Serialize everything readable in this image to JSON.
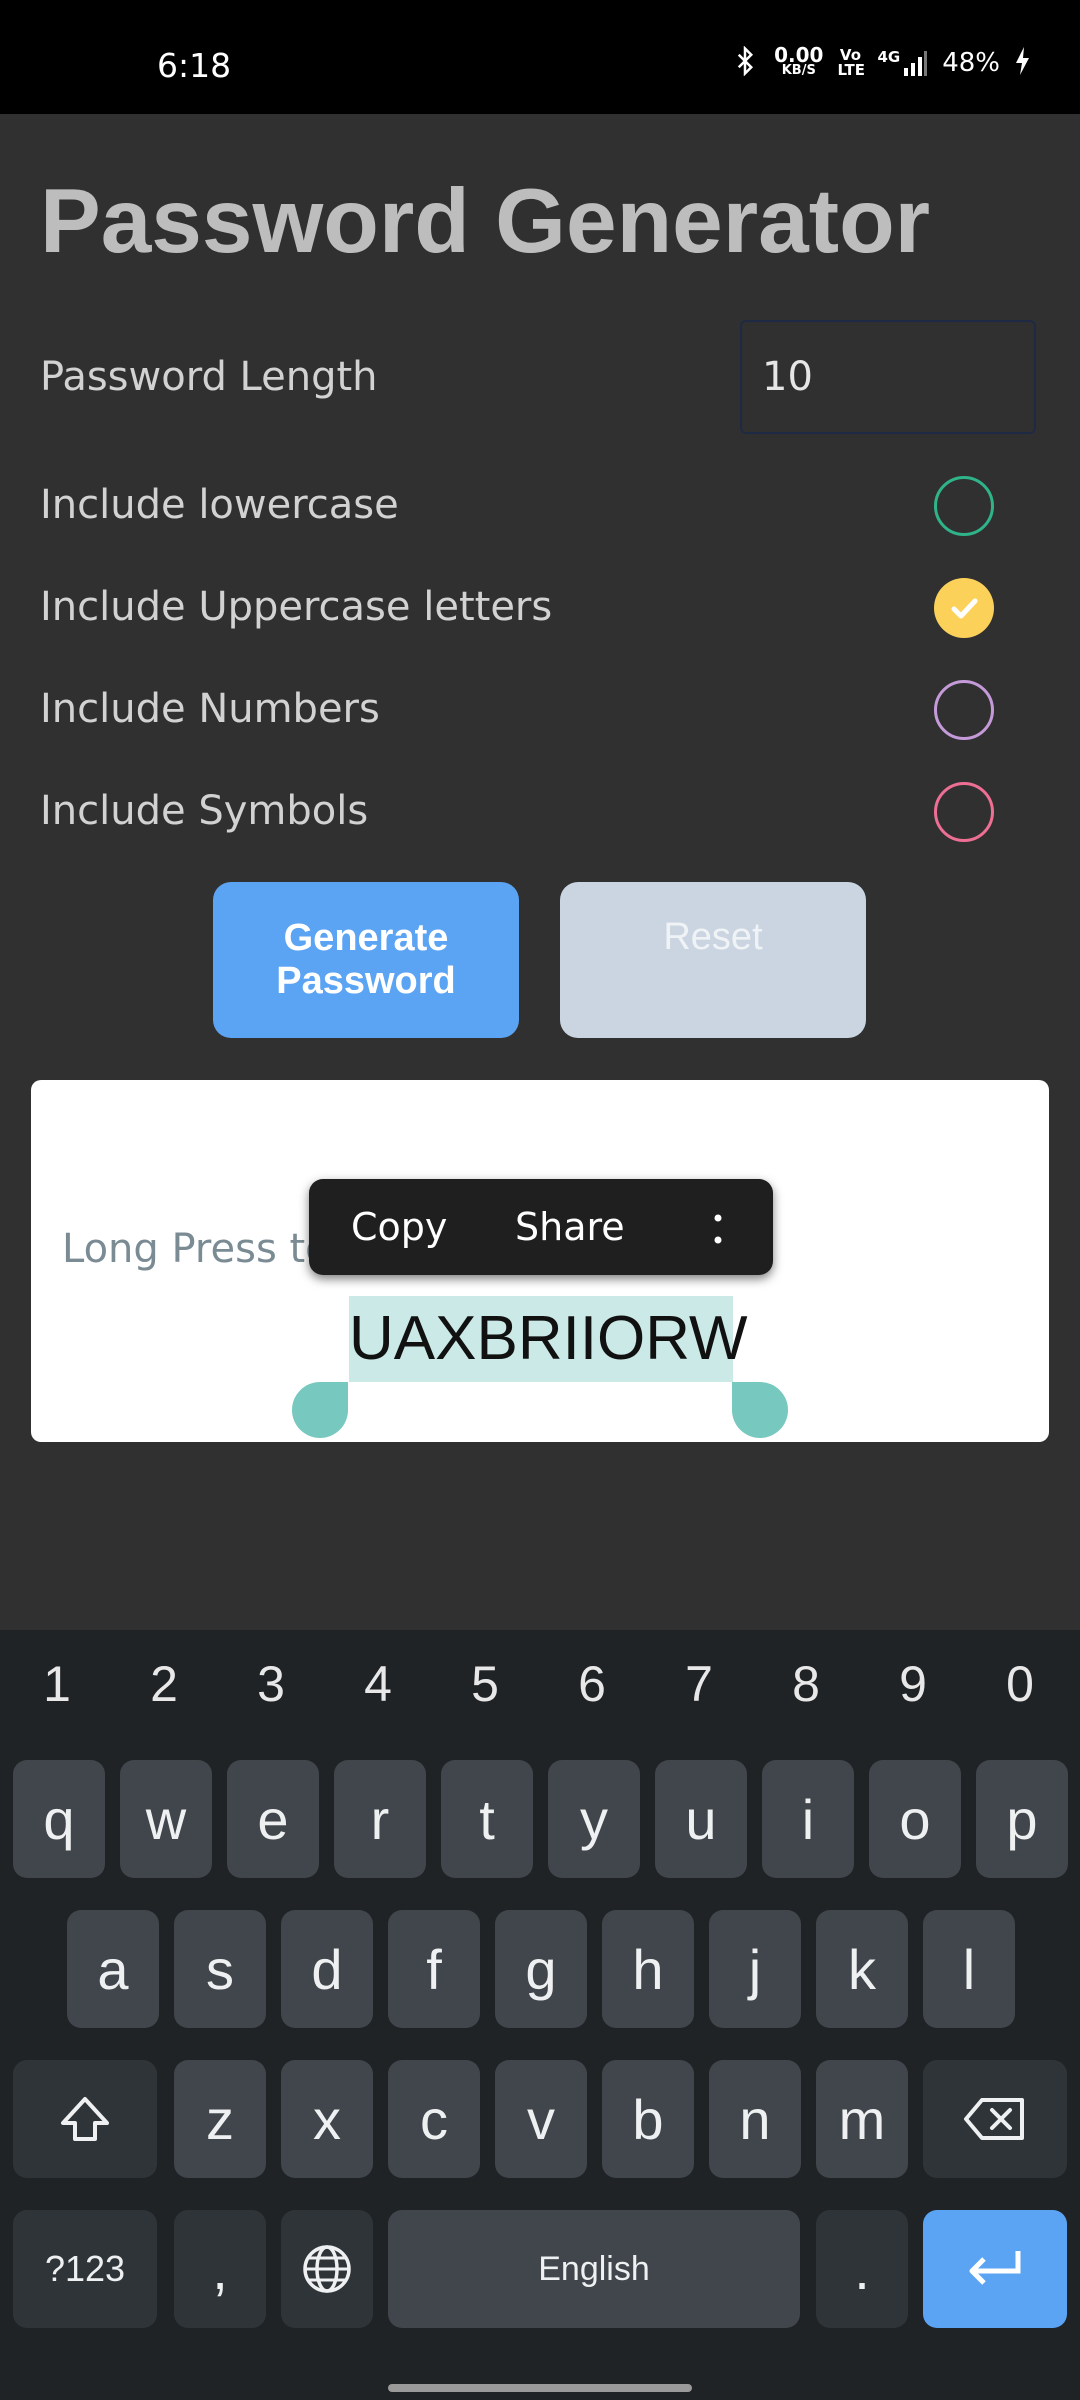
{
  "status_bar": {
    "time": "6:18",
    "net_speed": "0.00",
    "net_unit": "KB/S",
    "volte": "Vo LTE",
    "signal": "4G",
    "battery": "48%"
  },
  "app": {
    "title": "Password Generator",
    "length_label": "Password Length",
    "length_value": "10",
    "options": [
      {
        "label": "Include lowercase",
        "checked": false,
        "color": "#2fb389"
      },
      {
        "label": "Include Uppercase letters",
        "checked": true,
        "color": "#fcd15a"
      },
      {
        "label": "Include Numbers",
        "checked": false,
        "color": "#c49ad8"
      },
      {
        "label": "Include Symbols",
        "checked": false,
        "color": "#ee6f94"
      }
    ],
    "generate_label": "Generate\nPassword",
    "reset_label": "Reset",
    "hint_text": "Long Press to",
    "password": "UAXBRIIORW"
  },
  "context_menu": {
    "copy": "Copy",
    "share": "Share",
    "more_icon": "more-vertical-icon"
  },
  "keyboard": {
    "numbers": [
      "1",
      "2",
      "3",
      "4",
      "5",
      "6",
      "7",
      "8",
      "9",
      "0"
    ],
    "row1": [
      "q",
      "w",
      "e",
      "r",
      "t",
      "y",
      "u",
      "i",
      "o",
      "p"
    ],
    "row2": [
      "a",
      "s",
      "d",
      "f",
      "g",
      "h",
      "j",
      "k",
      "l"
    ],
    "row3": [
      "z",
      "x",
      "c",
      "v",
      "b",
      "n",
      "m"
    ],
    "symbols_key": "?123",
    "comma": ",",
    "space_label": "English",
    "period": ".",
    "icons": {
      "shift": "shift-icon",
      "backspace": "backspace-icon",
      "globe": "globe-icon",
      "enter": "enter-icon"
    }
  },
  "colors": {
    "generate_button": "#5ba3f3",
    "reset_button": "#cad5e1",
    "selection": "#cbe9e7",
    "selection_handle": "#77c8bf"
  }
}
